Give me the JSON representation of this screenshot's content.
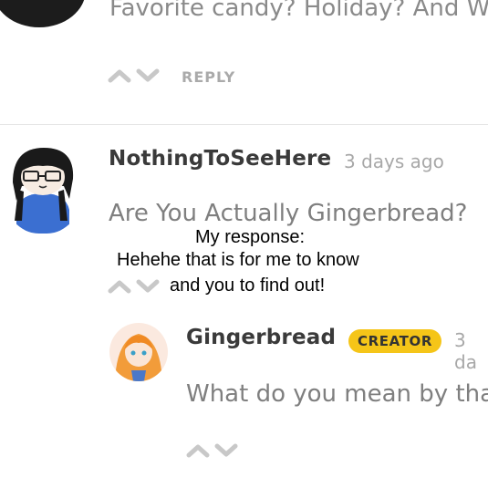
{
  "comment_prev": {
    "text": "Favorite candy? Holiday? And W",
    "reply_label": "REPLY"
  },
  "comment_main": {
    "username": "NothingToSeeHere",
    "time": "3 days ago",
    "text": "Are You Actually Gingerbread?"
  },
  "overlay": {
    "line1": "My response:",
    "line2": "Hehehe that is for me to know",
    "line3": "and you to find out!"
  },
  "reply_creator": {
    "username": "Gingerbread",
    "badge": "CREATOR",
    "time": "3 da",
    "text": "What do you mean by tha"
  },
  "icons": {
    "upvote": "chevron-up-icon",
    "downvote": "chevron-down-icon"
  },
  "colors": {
    "badge": "#f5c518",
    "text_muted": "#7f7f7f",
    "name": "#3a3a3a"
  }
}
